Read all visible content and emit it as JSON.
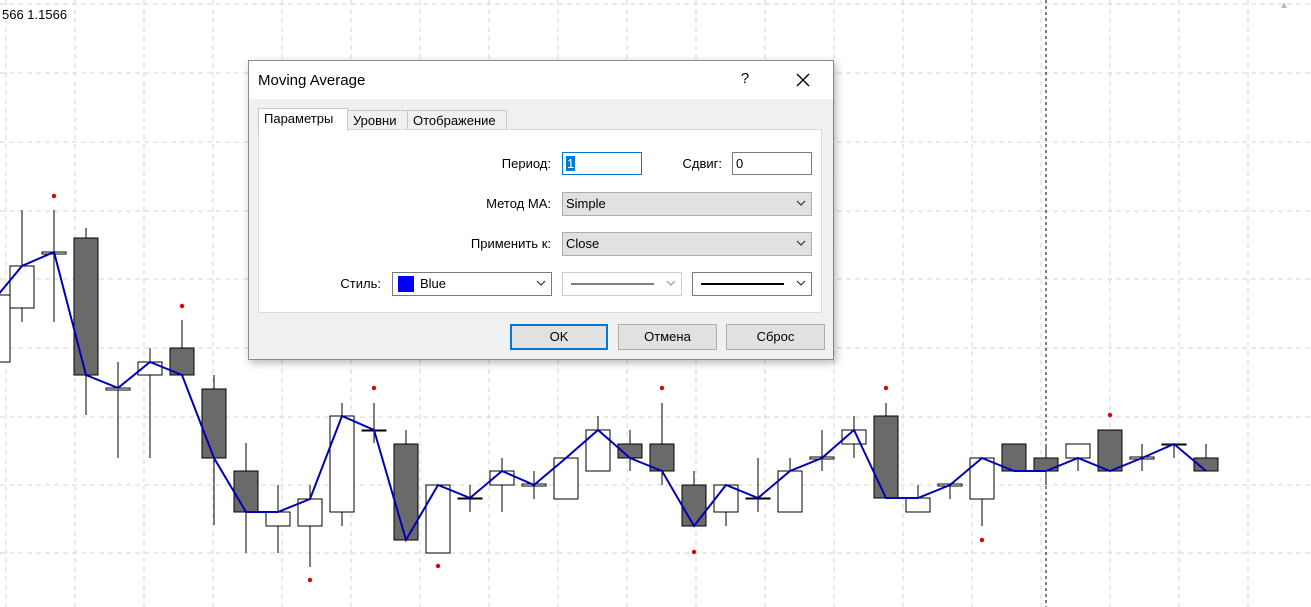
{
  "chart": {
    "price_label": "566 1.1566",
    "grid": true,
    "colors": {
      "bull_fill": "#ffffff",
      "bear_fill": "#6a6a6a",
      "wick": "#000000",
      "ma_line": "#0000b4",
      "fractal": "#e00000"
    }
  },
  "dialog": {
    "title": "Moving Average",
    "help": "?",
    "tabs": [
      {
        "label": "Параметры",
        "active": true
      },
      {
        "label": "Уровни",
        "active": false
      },
      {
        "label": "Отображение",
        "active": false
      }
    ],
    "fields": {
      "period_label": "Период:",
      "period_value": "1",
      "shift_label": "Сдвиг:",
      "shift_value": "0",
      "method_label": "Метод МА:",
      "method_value": "Simple",
      "apply_label": "Применить к:",
      "apply_value": "Close",
      "style_label": "Стиль:",
      "color_value": "Blue",
      "color_hex": "#0000ff"
    },
    "buttons": {
      "ok": "OK",
      "cancel": "Отмена",
      "reset": "Сброс"
    }
  }
}
